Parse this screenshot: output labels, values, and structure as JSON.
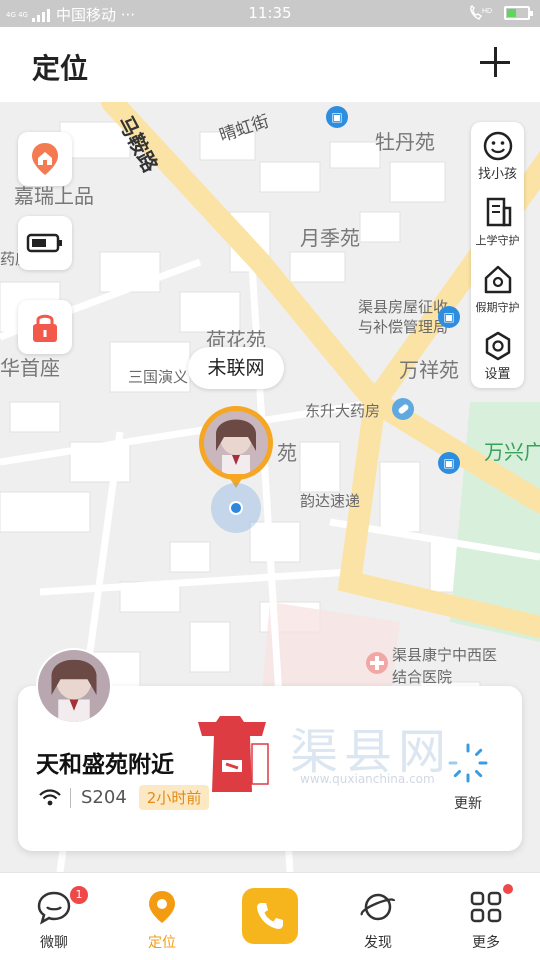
{
  "status_bar": {
    "network": "4G 4G",
    "carrier": "中国移动 ···",
    "time": "11:35",
    "hd": "HD"
  },
  "header": {
    "title": "定位",
    "add_icon": "plus-icon"
  },
  "map": {
    "labels": {
      "road_majuan": "马鞍路",
      "road_qinghong": "晴虹街",
      "mudanyuan": "牡丹苑",
      "jiayuan": "嘉瑞上品",
      "yaojian": "药房",
      "yuejiyuan": "月季苑",
      "fangwu_1": "渠县房屋征收",
      "fangwu_2": "与补偿管理局",
      "hehuayuan": "荷花苑",
      "huashouzuo": "华首座",
      "sanguo": "三国演义",
      "wanxiangyuan": "万祥苑",
      "dongsheng": "东升大药房",
      "wanxing": "万兴广",
      "yuan": "苑",
      "yunda": "韵达速递",
      "hospital_1": "渠县康宁中西医",
      "hospital_2": "结合医院"
    },
    "left_tools": [
      {
        "name": "home-icon"
      },
      {
        "name": "battery-icon"
      },
      {
        "name": "lock-icon"
      }
    ],
    "side_menu": [
      {
        "label": "找小孩",
        "icon": "smiley-icon"
      },
      {
        "label": "上学守护",
        "icon": "school-guard-icon"
      },
      {
        "label": "假期守护",
        "icon": "holiday-guard-icon"
      },
      {
        "label": "设置",
        "icon": "settings-icon"
      }
    ],
    "pin_tooltip": "未联网"
  },
  "card": {
    "location": "天和盛苑附近",
    "device": "S204",
    "time_ago": "2小时前",
    "refresh_label": "更新",
    "watermark_text": "渠县网",
    "watermark_url": "www.quxianchina.com"
  },
  "bottom_nav": [
    {
      "label": "微聊",
      "icon": "chat-icon",
      "badge": "1"
    },
    {
      "label": "定位",
      "icon": "location-icon",
      "active": true
    },
    {
      "label": "",
      "icon": "phone-icon"
    },
    {
      "label": "发现",
      "icon": "planet-icon"
    },
    {
      "label": "更多",
      "icon": "grid-icon"
    }
  ],
  "colors": {
    "accent": "#f39c12",
    "call_button": "#f7b51d",
    "road": "#fbe3a5",
    "badge": "#f04848"
  }
}
